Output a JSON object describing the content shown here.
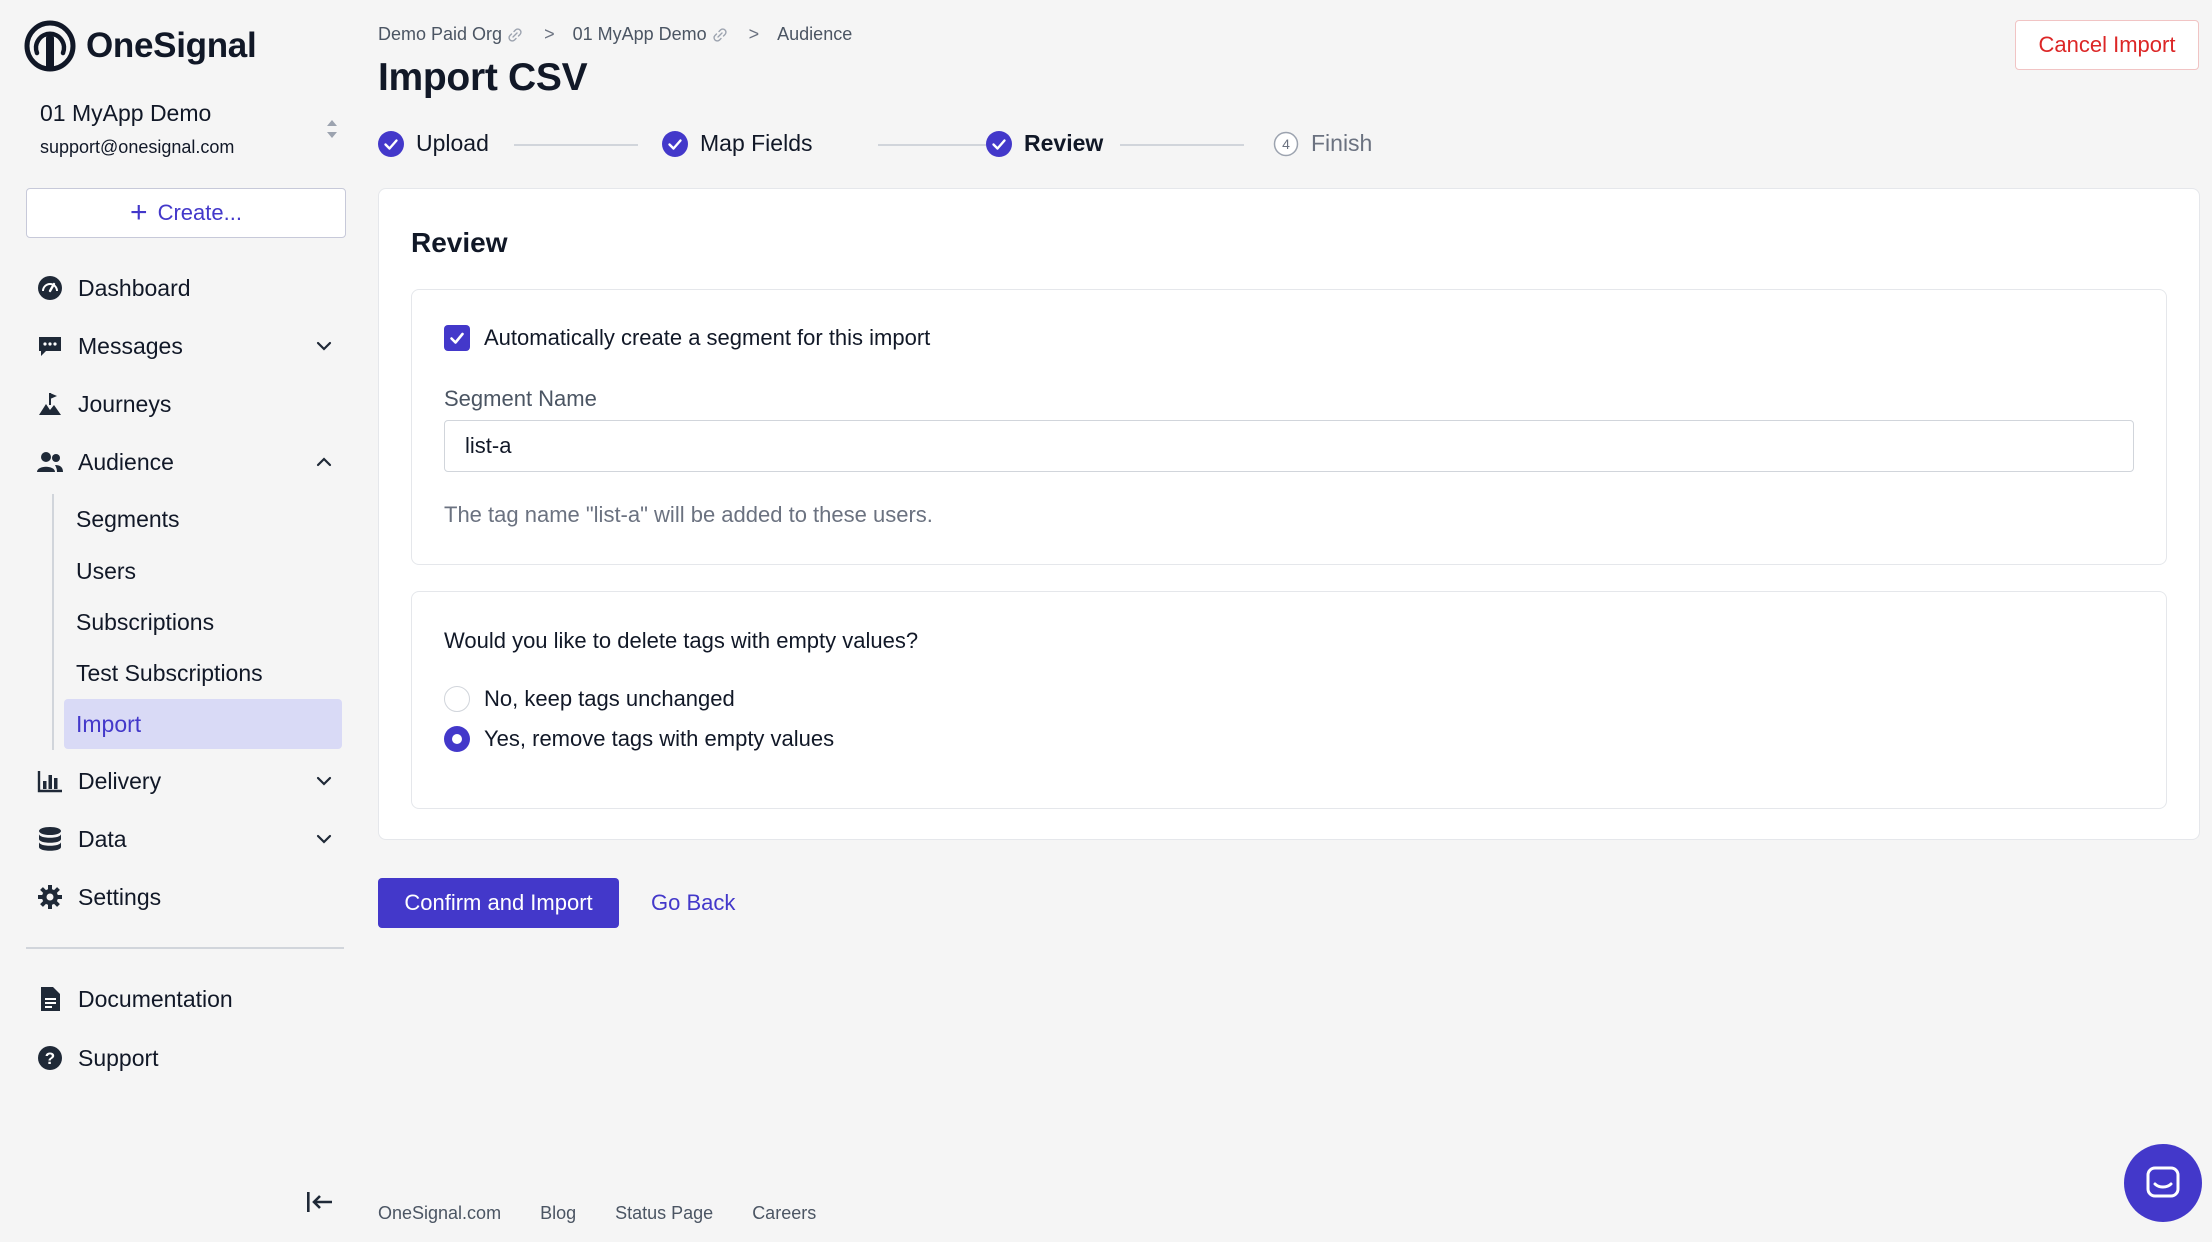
{
  "brand": {
    "name": "OneSignal",
    "accent": "#4338ca",
    "danger": "#dc2626"
  },
  "app_switcher": {
    "app_name": "01 MyApp Demo",
    "email": "support@onesignal.com",
    "icon": "up-down-arrows-icon"
  },
  "create_button": {
    "label": "Create...",
    "icon": "plus-icon"
  },
  "nav": {
    "dashboard": {
      "label": "Dashboard",
      "icon": "dashboard-gauge-icon"
    },
    "messages": {
      "label": "Messages",
      "icon": "chat-bubble-icon"
    },
    "journeys": {
      "label": "Journeys",
      "icon": "journeys-flag-icon"
    },
    "audience": {
      "label": "Audience",
      "icon": "users-icon"
    },
    "audience_sub": {
      "segments": "Segments",
      "users": "Users",
      "subscriptions": "Subscriptions",
      "test_subscriptions": "Test Subscriptions",
      "import": "Import"
    },
    "delivery": {
      "label": "Delivery",
      "icon": "bar-chart-icon"
    },
    "data": {
      "label": "Data",
      "icon": "database-icon"
    },
    "settings": {
      "label": "Settings",
      "icon": "gear-icon"
    },
    "documentation": {
      "label": "Documentation",
      "icon": "document-icon"
    },
    "support": {
      "label": "Support",
      "icon": "question-icon"
    }
  },
  "breadcrumb": {
    "org": "Demo Paid Org",
    "app": "01 MyApp Demo",
    "section": "Audience"
  },
  "page": {
    "title": "Import CSV",
    "cancel_label": "Cancel Import"
  },
  "stepper": {
    "upload": "Upload",
    "map_fields": "Map Fields",
    "review": "Review",
    "finish": "Finish",
    "finish_number": "4"
  },
  "review": {
    "title": "Review",
    "auto_segment_label": "Automatically create a segment for this import",
    "auto_segment_checked": true,
    "segment_name_label": "Segment Name",
    "segment_name_value": "list-a",
    "help_text": "The tag name \"list-a\" will be added to these users.",
    "delete_question": "Would you like to delete tags with empty values?",
    "option_keep": "No, keep tags unchanged",
    "option_remove": "Yes, remove tags with empty values",
    "selected_option": "option_remove"
  },
  "actions": {
    "confirm": "Confirm and Import",
    "go_back": "Go Back"
  },
  "footer": {
    "site": "OneSignal.com",
    "blog": "Blog",
    "status": "Status Page",
    "careers": "Careers"
  }
}
